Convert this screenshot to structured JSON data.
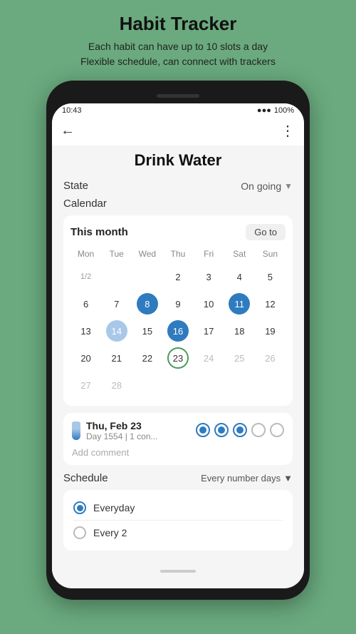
{
  "app_header": {
    "title": "Habit Tracker",
    "subtitle_line1": "Each habit can have up to 10 slots a day",
    "subtitle_line2": "Flexible schedule, can connect with trackers"
  },
  "status_bar": {
    "time": "10:43",
    "battery": "100%"
  },
  "screen": {
    "title": "Drink Water",
    "state_label": "State",
    "state_value": "On going",
    "calendar_label": "Calendar",
    "calendar": {
      "month_label": "This month",
      "go_to_label": "Go to",
      "weekdays": [
        "Mon",
        "Tue",
        "Wed",
        "Thu",
        "Fri",
        "Sat",
        "Sun"
      ],
      "rows": [
        [
          {
            "num": "1/2",
            "style": "half"
          },
          {
            "num": "",
            "style": ""
          },
          {
            "num": "",
            "style": ""
          },
          {
            "num": "2",
            "style": ""
          },
          {
            "num": "3",
            "style": ""
          },
          {
            "num": "4",
            "style": ""
          },
          {
            "num": "5",
            "style": ""
          }
        ],
        [
          {
            "num": "6",
            "style": ""
          },
          {
            "num": "7",
            "style": ""
          },
          {
            "num": "8",
            "style": "dark"
          },
          {
            "num": "9",
            "style": ""
          },
          {
            "num": "10",
            "style": ""
          },
          {
            "num": "11",
            "style": "dark"
          },
          {
            "num": "12",
            "style": ""
          }
        ],
        [
          {
            "num": "13",
            "style": ""
          },
          {
            "num": "14",
            "style": "light"
          },
          {
            "num": "15",
            "style": ""
          },
          {
            "num": "16",
            "style": "dark"
          },
          {
            "num": "17",
            "style": ""
          },
          {
            "num": "18",
            "style": ""
          },
          {
            "num": "19",
            "style": ""
          }
        ],
        [
          {
            "num": "20",
            "style": ""
          },
          {
            "num": "21",
            "style": ""
          },
          {
            "num": "22",
            "style": ""
          },
          {
            "num": "23",
            "style": "today"
          },
          {
            "num": "24",
            "style": "gray"
          },
          {
            "num": "25",
            "style": "gray"
          },
          {
            "num": "26",
            "style": "gray"
          }
        ],
        [
          {
            "num": "27",
            "style": "gray"
          },
          {
            "num": "28",
            "style": "gray"
          },
          {
            "num": "",
            "style": ""
          },
          {
            "num": "",
            "style": ""
          },
          {
            "num": "",
            "style": ""
          },
          {
            "num": "",
            "style": ""
          },
          {
            "num": "",
            "style": ""
          }
        ]
      ]
    },
    "day_detail": {
      "date": "Thu, Feb 23",
      "sub": "Day 1554 | 1 con...",
      "dots": [
        "filled",
        "filled",
        "filled",
        "empty",
        "empty"
      ],
      "add_comment": "Add comment"
    },
    "schedule_label": "Schedule",
    "schedule_value": "Every number days",
    "schedule_options": [
      {
        "label": "Everyday",
        "selected": true
      },
      {
        "label": "Every 2",
        "selected": false
      }
    ]
  }
}
